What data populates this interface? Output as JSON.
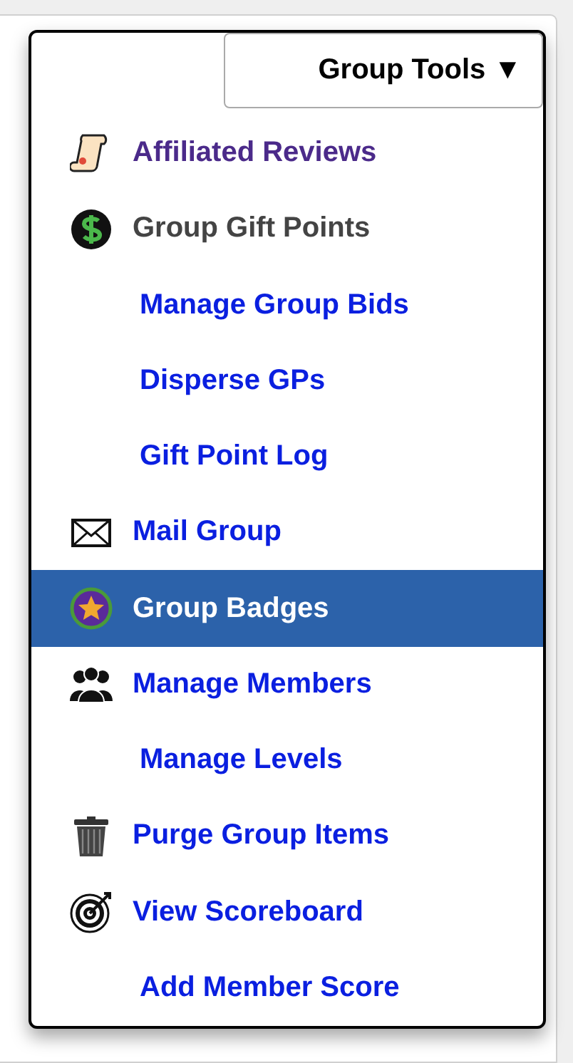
{
  "dropdown_button": {
    "label": "Group Tools ▼"
  },
  "menu_items": [
    {
      "label": "Affiliated Reviews",
      "kind": "scroll",
      "link": true,
      "visited": true,
      "selected": false
    },
    {
      "label": "Group Gift Points",
      "kind": "money",
      "link": false,
      "visited": false,
      "selected": false
    },
    {
      "label": "Manage Group Bids",
      "kind": "sub",
      "link": true,
      "visited": false,
      "selected": false
    },
    {
      "label": "Disperse GPs",
      "kind": "sub",
      "link": true,
      "visited": false,
      "selected": false
    },
    {
      "label": "Gift Point Log",
      "kind": "sub",
      "link": true,
      "visited": false,
      "selected": false
    },
    {
      "label": "Mail Group",
      "kind": "mail",
      "link": true,
      "visited": false,
      "selected": false
    },
    {
      "label": "Group Badges",
      "kind": "badge",
      "link": true,
      "visited": false,
      "selected": true
    },
    {
      "label": "Manage Members",
      "kind": "members",
      "link": true,
      "visited": false,
      "selected": false
    },
    {
      "label": "Manage Levels",
      "kind": "sub",
      "link": true,
      "visited": false,
      "selected": false
    },
    {
      "label": "Purge Group Items",
      "kind": "trash",
      "link": true,
      "visited": false,
      "selected": false
    },
    {
      "label": "View Scoreboard",
      "kind": "target",
      "link": true,
      "visited": false,
      "selected": false
    },
    {
      "label": "Add Member Score",
      "kind": "sub",
      "link": true,
      "visited": false,
      "selected": false
    }
  ]
}
